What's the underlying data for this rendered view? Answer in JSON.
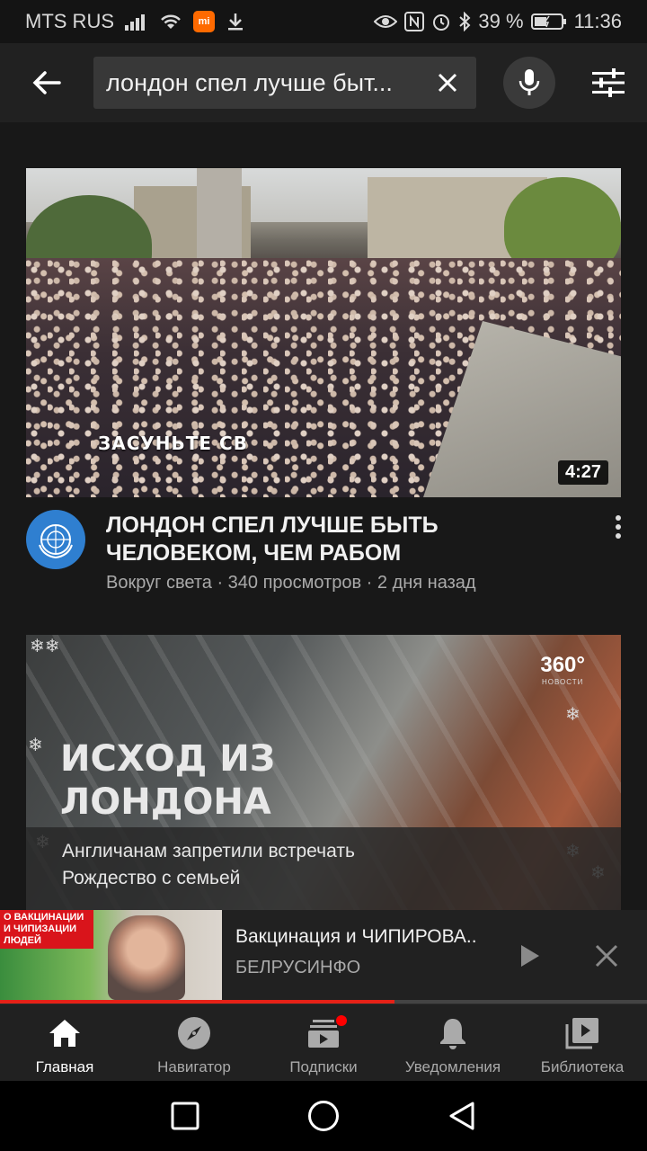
{
  "status_bar": {
    "carrier": "MTS RUS",
    "battery": "39 %",
    "time": "11:36",
    "icons": [
      "signal-icon",
      "wifi-icon",
      "mi-app-icon",
      "download-icon",
      "eye-icon",
      "nfc-icon",
      "alarm-icon",
      "bluetooth-icon",
      "battery-icon"
    ]
  },
  "search": {
    "query": "лондон спел лучше быт..."
  },
  "video1": {
    "title": "ЛОНДОН СПЕЛ  ЛУЧШЕ БЫТЬ ЧЕЛОВЕКОМ, ЧЕМ РАБОМ",
    "subtitle": "Вокруг света · 340 просмотров · 2 дня назад",
    "duration": "4:27",
    "overlay_text": "ЗАСУНЬТЕ СВ"
  },
  "video2": {
    "headline_line1": "ИСХОД ИЗ",
    "headline_line2": "ЛОНДОНА",
    "subline1": "Англичанам запретили встречать",
    "subline2": "Рождество с семьей",
    "brand": "360°",
    "brand_sub": "НОВОСТИ"
  },
  "miniplayer": {
    "tag": "О ВАКЦИНАЦИИ И ЧИПИЗАЦИИ ЛЮДЕЙ",
    "title": "Вакцинация и ЧИПИРОВА..",
    "channel": "БЕЛРУСИНФО",
    "progress": 0.61
  },
  "bottom_nav": [
    {
      "label": "Главная",
      "icon": "home-icon",
      "active": true
    },
    {
      "label": "Навигатор",
      "icon": "compass-icon",
      "active": false
    },
    {
      "label": "Подписки",
      "icon": "subscriptions-icon",
      "active": false
    },
    {
      "label": "Уведомления",
      "icon": "bell-icon",
      "active": false
    },
    {
      "label": "Библиотека",
      "icon": "library-icon",
      "active": false
    }
  ],
  "colors": {
    "background": "#181818",
    "surface": "#212121",
    "accent_red": "#e62117",
    "text_secondary": "#aaaaaa"
  }
}
